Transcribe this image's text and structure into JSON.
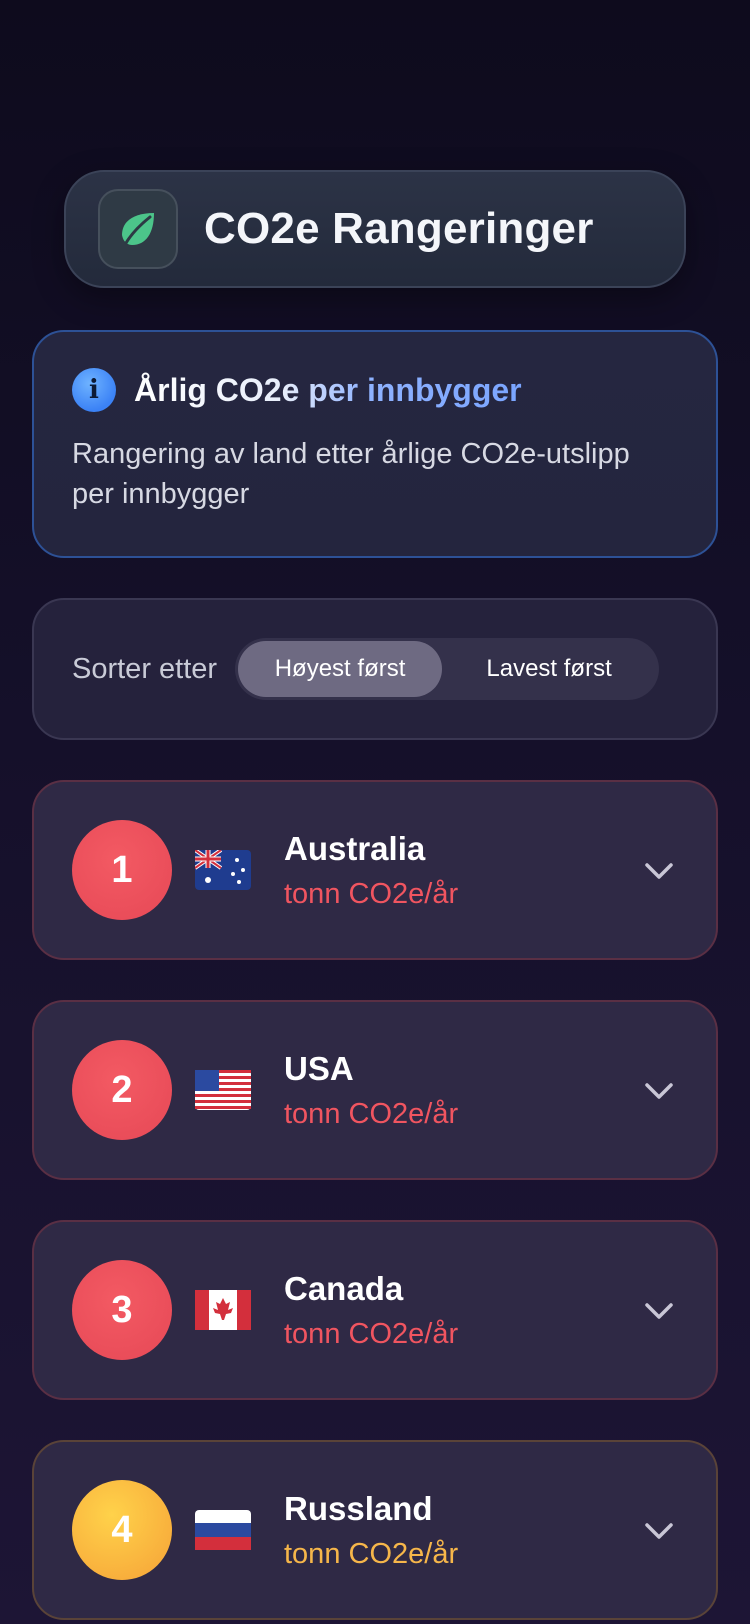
{
  "header": {
    "title": "CO2e Rangeringer",
    "icon": "leaf-icon"
  },
  "info": {
    "icon": "info-icon",
    "title": "Årlig CO2e per innbygger",
    "description": "Rangering av land etter årlige CO2e-utslipp per innbygger"
  },
  "sort": {
    "label": "Sorter etter",
    "options": [
      "Høyest først",
      "Lavest først"
    ],
    "selected": "Høyest først"
  },
  "countries": [
    {
      "rank": "1",
      "name": "Australia",
      "unit": "tonn CO2e/år",
      "flag": "australia-flag-icon",
      "color": "#f05560"
    },
    {
      "rank": "2",
      "name": "USA",
      "unit": "tonn CO2e/år",
      "flag": "usa-flag-icon",
      "color": "#f05560"
    },
    {
      "rank": "3",
      "name": "Canada",
      "unit": "tonn CO2e/år",
      "flag": "canada-flag-icon",
      "color": "#f05560"
    },
    {
      "rank": "4",
      "name": "Russland",
      "unit": "tonn CO2e/år",
      "flag": "russia-flag-icon",
      "color": "#f6b64a"
    }
  ]
}
